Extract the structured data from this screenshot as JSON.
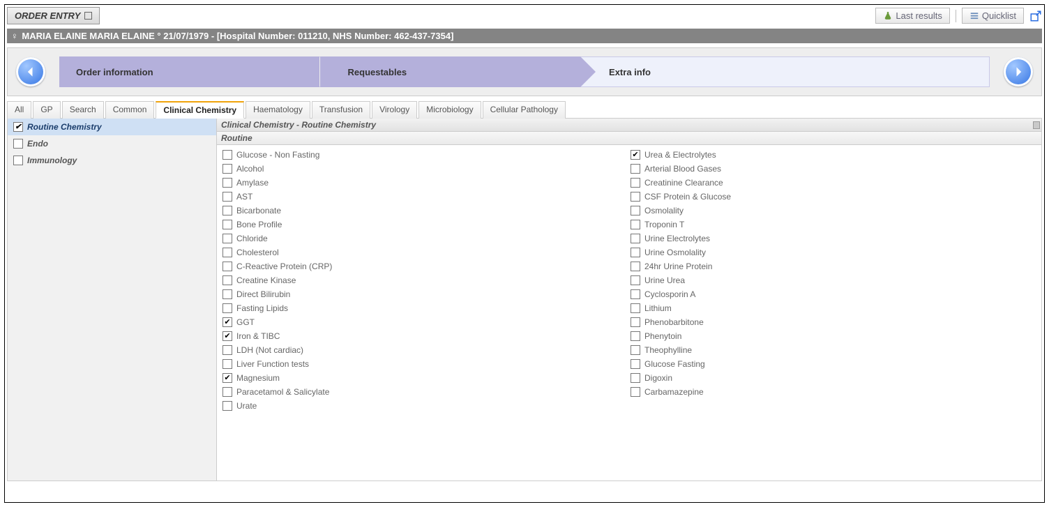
{
  "header": {
    "title_label": "ORDER ENTRY",
    "last_results_label": "Last results",
    "quicklist_label": "Quicklist"
  },
  "patient_bar": "MARIA ELAINE MARIA ELAINE ° 21/07/1979 - [Hospital Number: 011210, NHS Number: 462-437-7354]",
  "breadcrumb": {
    "step1": "Order information",
    "step2": "Requestables",
    "step3": "Extra info"
  },
  "tabs": [
    "All",
    "GP",
    "Search",
    "Common",
    "Clinical Chemistry",
    "Haematology",
    "Transfusion",
    "Virology",
    "Microbiology",
    "Cellular Pathology"
  ],
  "active_tab_index": 4,
  "sidebar": [
    {
      "label": "Routine Chemistry",
      "checked": true,
      "selected": true
    },
    {
      "label": "Endo",
      "checked": false,
      "selected": false
    },
    {
      "label": "Immunology",
      "checked": false,
      "selected": false
    }
  ],
  "panel_title": "Clinical Chemistry - Routine Chemistry",
  "subgroup_title": "Routine",
  "tests_left": [
    {
      "label": "Glucose  - Non Fasting",
      "checked": false
    },
    {
      "label": "Alcohol",
      "checked": false
    },
    {
      "label": "Amylase",
      "checked": false
    },
    {
      "label": "AST",
      "checked": false
    },
    {
      "label": "Bicarbonate",
      "checked": false
    },
    {
      "label": "Bone Profile",
      "checked": false
    },
    {
      "label": "Chloride",
      "checked": false
    },
    {
      "label": "Cholesterol",
      "checked": false
    },
    {
      "label": "C-Reactive Protein (CRP)",
      "checked": false
    },
    {
      "label": "Creatine Kinase",
      "checked": false
    },
    {
      "label": "Direct Bilirubin",
      "checked": false
    },
    {
      "label": "Fasting Lipids",
      "checked": false
    },
    {
      "label": "GGT",
      "checked": true
    },
    {
      "label": "Iron & TIBC",
      "checked": true
    },
    {
      "label": "LDH (Not cardiac)",
      "checked": false
    },
    {
      "label": "Liver Function tests",
      "checked": false
    },
    {
      "label": "Magnesium",
      "checked": true
    },
    {
      "label": "Paracetamol & Salicylate",
      "checked": false
    },
    {
      "label": "Urate",
      "checked": false
    }
  ],
  "tests_right": [
    {
      "label": "Urea & Electrolytes",
      "checked": true
    },
    {
      "label": "Arterial Blood Gases",
      "checked": false
    },
    {
      "label": "Creatinine Clearance",
      "checked": false
    },
    {
      "label": "CSF Protein & Glucose",
      "checked": false
    },
    {
      "label": "Osmolality",
      "checked": false
    },
    {
      "label": "Troponin T",
      "checked": false
    },
    {
      "label": "Urine Electrolytes",
      "checked": false
    },
    {
      "label": "Urine Osmolality",
      "checked": false
    },
    {
      "label": "24hr Urine Protein",
      "checked": false
    },
    {
      "label": "Urine Urea",
      "checked": false
    },
    {
      "label": "Cyclosporin A",
      "checked": false
    },
    {
      "label": "Lithium",
      "checked": false
    },
    {
      "label": "Phenobarbitone",
      "checked": false
    },
    {
      "label": "Phenytoin",
      "checked": false
    },
    {
      "label": "Theophylline",
      "checked": false
    },
    {
      "label": "Glucose Fasting",
      "checked": false
    },
    {
      "label": "Digoxin",
      "checked": false
    },
    {
      "label": "Carbamazepine",
      "checked": false
    }
  ]
}
